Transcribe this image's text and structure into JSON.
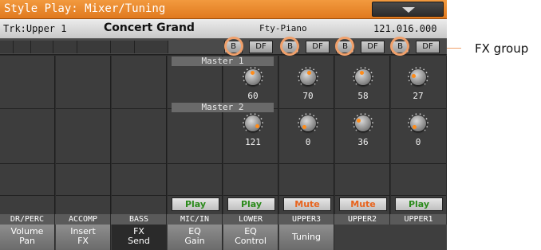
{
  "title": "Style Play: Mixer/Tuning",
  "info": {
    "track": "Trk:Upper 1",
    "sound": "Concert Grand",
    "bank": "Fty-Piano",
    "position": "121.016.000"
  },
  "fx_buttons": {
    "b": "B",
    "df": "DF"
  },
  "master1_label": "Master 1",
  "master2_label": "Master 2",
  "master1_values": [
    "60",
    "70",
    "58",
    "27"
  ],
  "master2_values": [
    "121",
    "0",
    "36",
    "0"
  ],
  "play_buttons": [
    "Play",
    "Play",
    "Mute",
    "Mute",
    "Play"
  ],
  "channel_labels": [
    "DR/PERC",
    "ACCOMP",
    "BASS",
    "MIC/IN",
    "LOWER",
    "UPPER3",
    "UPPER2",
    "UPPER1"
  ],
  "tabs": [
    {
      "l1": "Volume",
      "l2": "Pan"
    },
    {
      "l1": "Insert",
      "l2": "FX"
    },
    {
      "l1": "FX",
      "l2": "Send"
    },
    {
      "l1": "EQ",
      "l2": "Gain"
    },
    {
      "l1": "EQ",
      "l2": "Control"
    },
    {
      "l1": "Tuning",
      "l2": ""
    }
  ],
  "callout": "FX group",
  "colors": {
    "accent": "#e0791e",
    "play": "#2a8a1a",
    "mute": "#e8641e",
    "knob_dot": "#ff8c1a",
    "ring": "#f0a06b"
  }
}
